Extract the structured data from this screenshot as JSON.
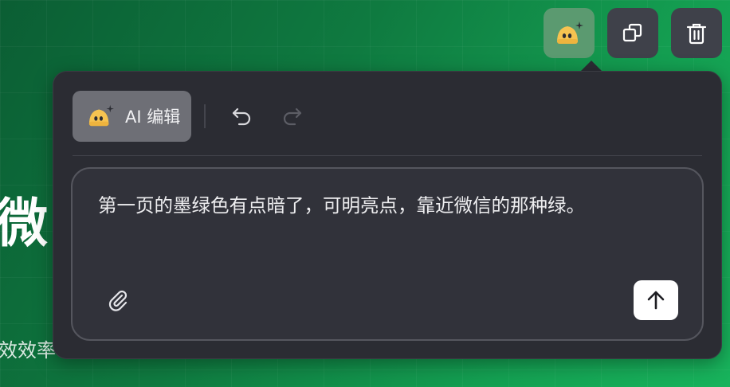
{
  "slide": {
    "title_partial": "微",
    "subtitle_partial": "效效率"
  },
  "toolbar": {
    "items": [
      {
        "icon": "ai-mascot-icon",
        "active": true
      },
      {
        "icon": "copy-icon"
      },
      {
        "icon": "trash-icon"
      }
    ]
  },
  "panel": {
    "ai_edit_label": "AI 编辑",
    "prompt_text": "第一页的墨绿色有点暗了，可明亮点，靠近微信的那种绿。",
    "icons": [
      "undo-icon",
      "redo-icon",
      "paperclip-icon",
      "arrow-up-icon"
    ]
  },
  "colors": {
    "panel_bg": "#2b2c33",
    "ai_active_bg": "#5b9a70",
    "mascot_yellow": "#f6c351"
  }
}
